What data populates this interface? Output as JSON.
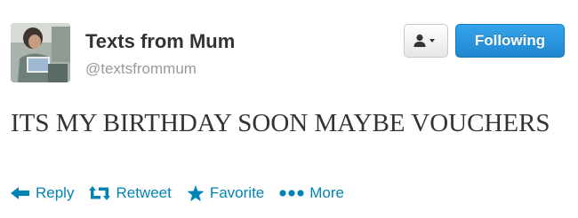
{
  "account": {
    "display_name": "Texts from Mum",
    "screen_name": "@textsfrommum"
  },
  "buttons": {
    "follow_label": "Following"
  },
  "tweet": {
    "text": "ITS MY BIRTHDAY SOON MAYBE VOUCHERS"
  },
  "actions": [
    {
      "label": "Reply",
      "icon": "reply-icon"
    },
    {
      "label": "Retweet",
      "icon": "retweet-icon"
    },
    {
      "label": "Favorite",
      "icon": "star-icon"
    },
    {
      "label": "More",
      "icon": "ellipsis-icon"
    }
  ],
  "colors": {
    "link": "#0084b4",
    "follow_button": "#2b97de",
    "name": "#333333",
    "handle": "#999999"
  }
}
